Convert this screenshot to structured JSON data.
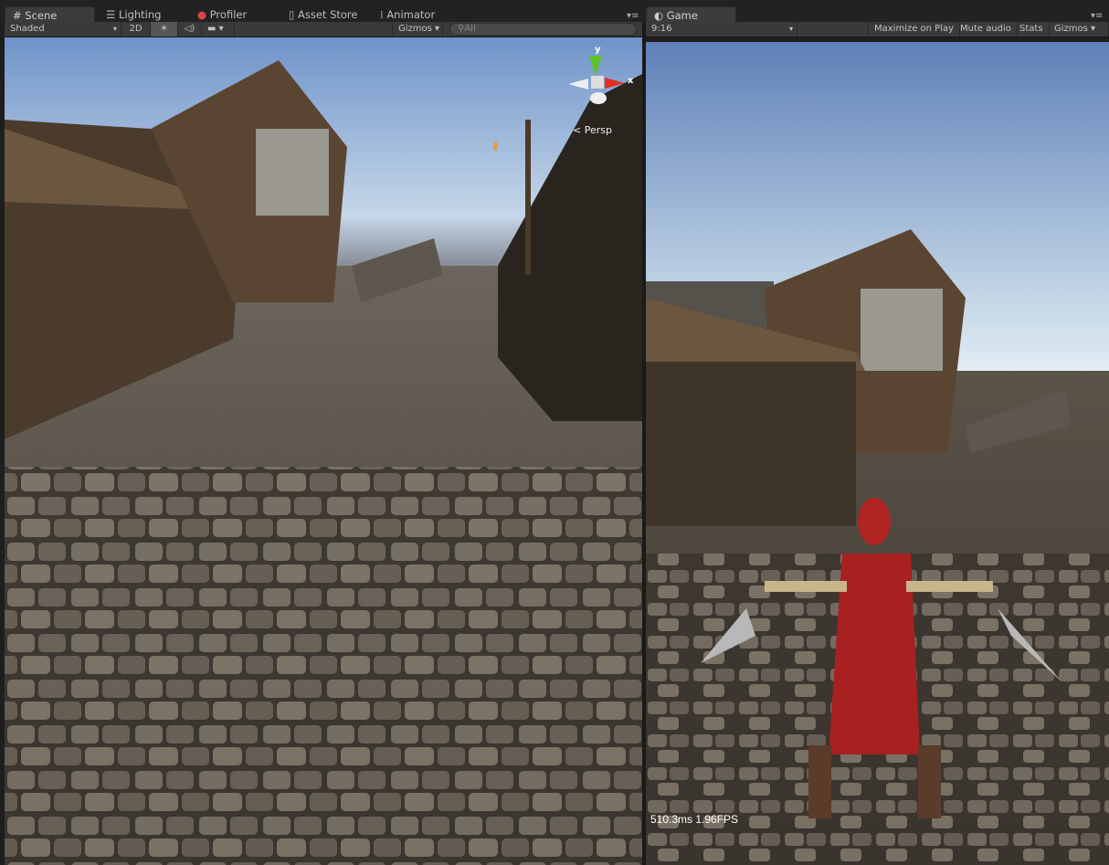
{
  "scene_panel": {
    "tabs": [
      {
        "label": "Scene",
        "icon": "grid-icon",
        "active": true
      },
      {
        "label": "Lighting",
        "icon": "lighting-icon"
      },
      {
        "label": "Profiler",
        "icon": "profiler-icon"
      },
      {
        "label": "Asset Store",
        "icon": "asset-store-icon"
      },
      {
        "label": "Animator",
        "icon": "animator-icon"
      }
    ],
    "toolbar": {
      "draw_mode": "Shaded",
      "mode_2d": "2D",
      "gizmos": "Gizmos",
      "search_placeholder": "All"
    },
    "gizmo": {
      "y_label": "y",
      "x_label": "x",
      "projection": "Persp"
    }
  },
  "game_panel": {
    "tab": {
      "label": "Game",
      "icon": "game-icon"
    },
    "toolbar": {
      "aspect": "9:16",
      "maximize_on_play": "Maximize on Play",
      "mute_audio": "Mute audio",
      "stats": "Stats",
      "gizmos": "Gizmos"
    },
    "fps_overlay": "510.3ms 1.96FPS"
  },
  "colors": {
    "sky_top": "#6f93c9",
    "horizon": "#e6eef4",
    "ground": "#5a5247",
    "accent_red": "#b02424"
  }
}
